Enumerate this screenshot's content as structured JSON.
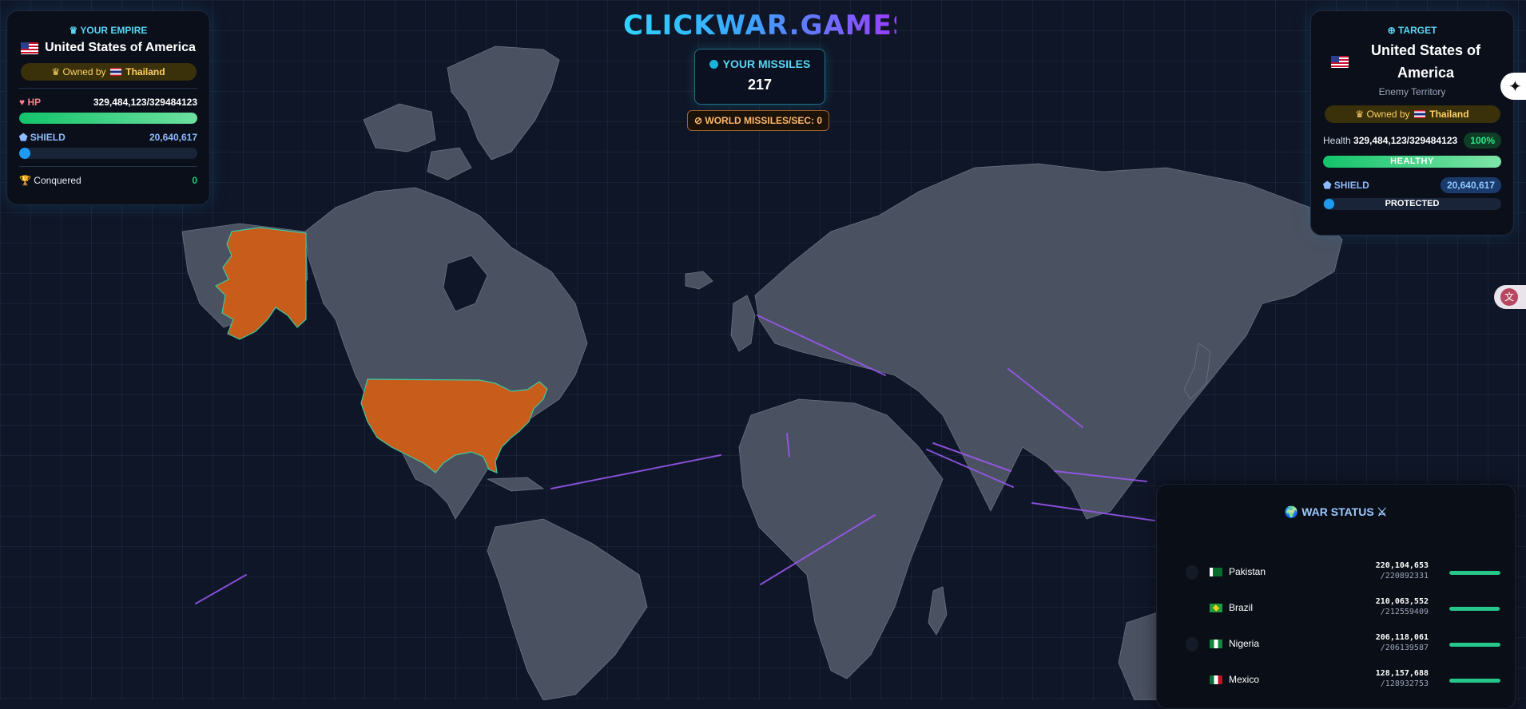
{
  "brand": {
    "title": "CLICKWAR.GAMES"
  },
  "missiles": {
    "label": "YOUR MISSILES",
    "count": "217",
    "world_rate_label": "WORLD MISSILES/SEC: 0"
  },
  "empire": {
    "header": "YOUR EMPIRE",
    "header_icon": "crown-icon",
    "country": "United States of America",
    "owned_prefix": "Owned by",
    "owner": "Thailand",
    "hp_label": "HP",
    "hp_value": "329,484,123/329484123",
    "hp_fraction": 1.0,
    "shield_label": "SHIELD",
    "shield_value": "20,640,617",
    "conquered_label": "Conquered",
    "conquered_value": "0"
  },
  "target": {
    "header": "TARGET",
    "header_icon": "crosshair-icon",
    "country": "United States of America",
    "subtitle": "Enemy Territory",
    "owned_prefix": "Owned by",
    "owner": "Thailand",
    "health_label": "Health",
    "health_value": "329,484,123/329484123",
    "health_pct": "100%",
    "health_status": "HEALTHY",
    "shield_label": "SHIELD",
    "shield_value": "20,640,617",
    "shield_status": "PROTECTED"
  },
  "war_status": {
    "title": "WAR STATUS",
    "rows": [
      {
        "country": "Pakistan",
        "hp": "220,104,653",
        "max": "/220892331",
        "fraction": 0.996
      },
      {
        "country": "Brazil",
        "hp": "210,063,552",
        "max": "/212559409",
        "fraction": 0.988
      },
      {
        "country": "Nigeria",
        "hp": "206,118,061",
        "max": "/206139587",
        "fraction": 0.999
      },
      {
        "country": "Mexico",
        "hp": "128,157,688",
        "max": "/128932753",
        "fraction": 0.994
      }
    ]
  },
  "colors": {
    "land": "#4a5160",
    "selected_country": "#c75c1b",
    "missile_trail": "#9c59f5",
    "background": "#0f1627"
  }
}
